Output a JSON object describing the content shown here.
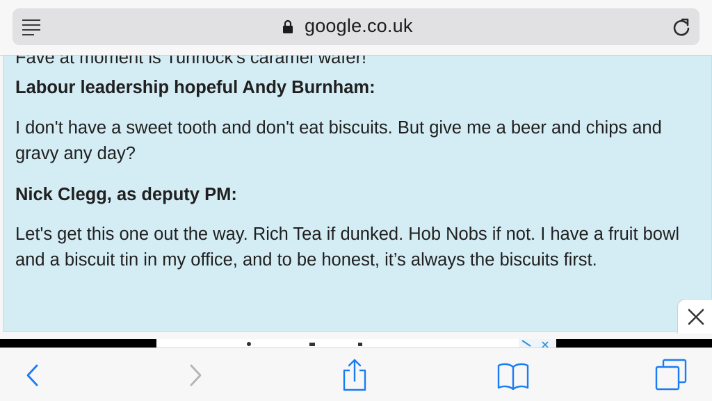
{
  "address_bar": {
    "url": "google.co.uk",
    "icons": [
      "reader-mode-icon",
      "lock-icon",
      "reload-icon"
    ]
  },
  "article": {
    "cut_off_line": "Fave at moment is Tunnock's caramel wafer!",
    "quotes": [
      {
        "speaker": "Labour leadership hopeful Andy Burnham:",
        "text": "I don't have a sweet tooth and don't eat biscuits. But give me a beer and chips and gravy any day?"
      },
      {
        "speaker": "Nick Clegg, as deputy PM:",
        "text": "Let's get this one out the way. Rich Tea if dunked. Hob Nobs if not. I have a fruit bowl and a biscuit tin in my office, and to be honest, it’s always the biscuits first."
      }
    ]
  },
  "ad": {
    "close_icon": "close-icon",
    "choices_icon": "adchoices-icon"
  },
  "toolbar": {
    "icons": [
      "back-icon",
      "forward-icon",
      "share-icon",
      "bookmarks-icon",
      "tabs-icon"
    ]
  },
  "colors": {
    "accent": "#1a7cf5",
    "disabled": "#b4b4b4",
    "article_bg": "#d4edf5"
  }
}
